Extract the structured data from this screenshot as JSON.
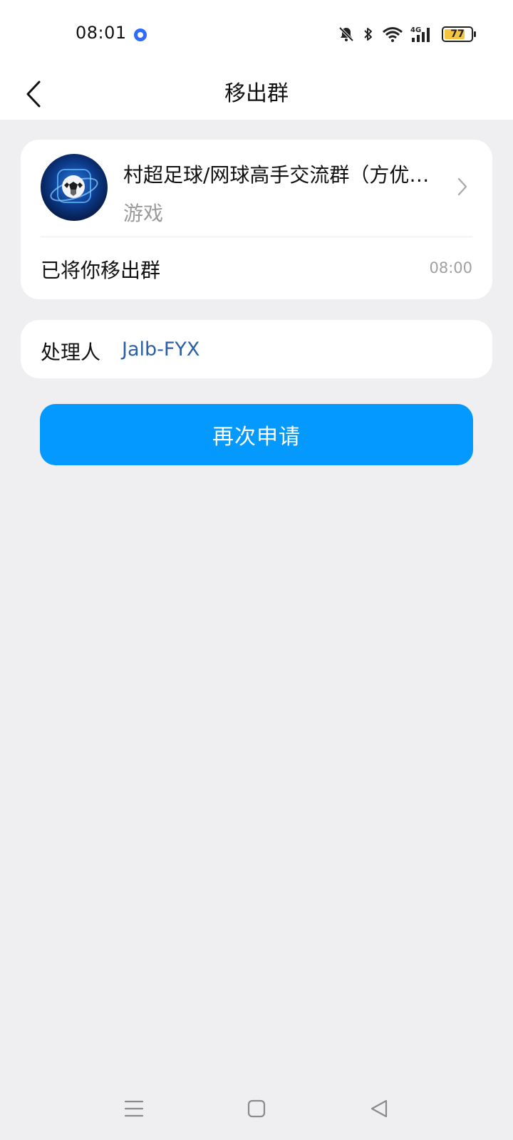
{
  "status": {
    "time": "08:01",
    "network": "4G",
    "battery": 77
  },
  "nav": {
    "title": "移出群"
  },
  "group": {
    "name": "村超足球/网球高手交流群（方优…",
    "category": "游戏",
    "removed_text": "已将你移出群",
    "removed_time": "08:00"
  },
  "handler": {
    "label": "处理人",
    "name": "Jalb-FYX"
  },
  "actions": {
    "reapply_label": "再次申请"
  },
  "colors": {
    "accent": "#0399fe",
    "link": "#2c5fa8",
    "background": "#efeff2"
  }
}
